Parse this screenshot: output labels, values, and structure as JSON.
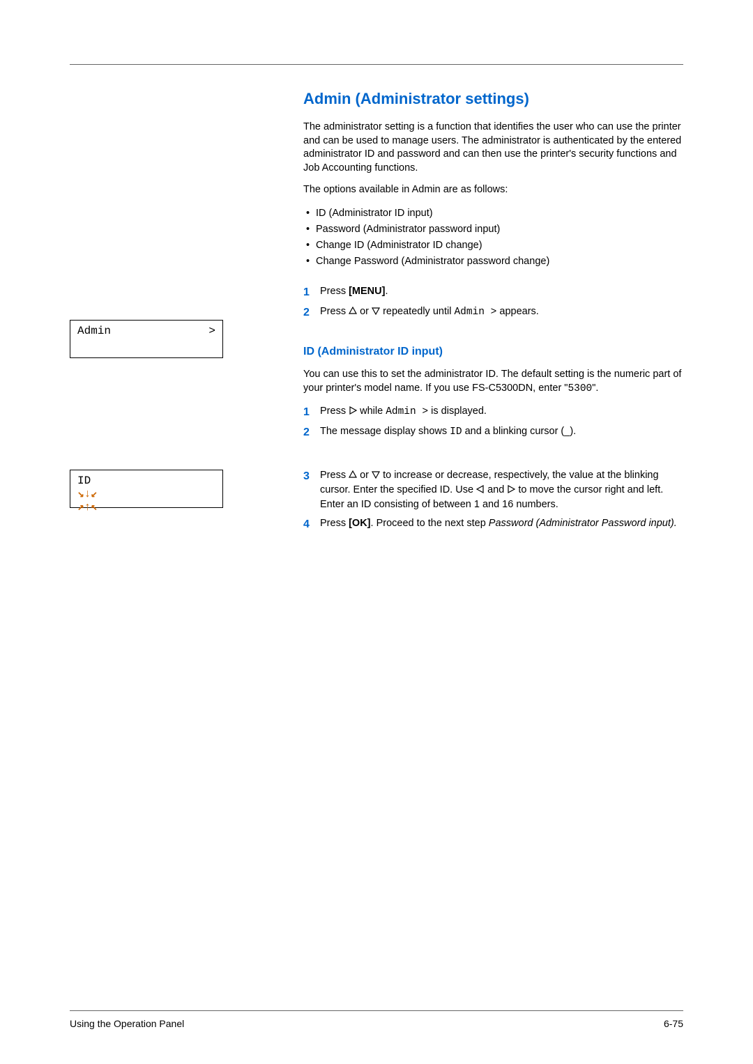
{
  "heading": "Admin (Administrator settings)",
  "intro1": "The administrator setting is a function that identifies the user who can use the printer and can be used to manage users. The administrator is authenticated by the entered administrator ID and password and can then use the printer's security functions and Job Accounting functions.",
  "intro2": "The options available in Admin are as follows:",
  "options": [
    "ID (Administrator ID input)",
    "Password (Administrator password input)",
    "Change ID (Administrator ID change)",
    "Change Password (Administrator password change)"
  ],
  "step_a1_pre": "Press ",
  "step_a1_strong": "[MENU]",
  "step_a1_post": ".",
  "step_a2_pre": "Press ",
  "step_a2_mid": " or ",
  "step_a2_post1": " repeatedly until ",
  "step_a2_mono": "Admin >",
  "step_a2_post2": " appears.",
  "display1": {
    "label": "Admin",
    "right": ">"
  },
  "subheading": "ID (Administrator ID input)",
  "sub_intro_a": "You can use this to set the administrator ID. The default setting is the numeric part of your printer's model name. If you use FS-C5300DN, enter \"",
  "sub_intro_mono": "5300",
  "sub_intro_b": "\".",
  "step_b1_pre": "Press ",
  "step_b1_mid": " while ",
  "step_b1_mono": "Admin >",
  "step_b1_post": " is displayed.",
  "step_b2_pre": "The message display shows ",
  "step_b2_mono": "ID",
  "step_b2_post": " and a blinking cursor (_).",
  "display2": {
    "label": "ID"
  },
  "step_b3_pre": "Press ",
  "step_b3_or": " or ",
  "step_b3_mid": " to increase or decrease, respectively, the value at the blinking cursor. Enter the specified ID. Use ",
  "step_b3_and": " and ",
  "step_b3_post": " to move the cursor right and left. Enter an ID consisting of between 1 and 16 numbers.",
  "step_b4_pre": "Press ",
  "step_b4_strong": "[OK]",
  "step_b4_mid": ". Proceed to the next step ",
  "step_b4_italic": "Password (Administrator Password input).",
  "footer_left": "Using the Operation Panel",
  "footer_right": "6-75"
}
